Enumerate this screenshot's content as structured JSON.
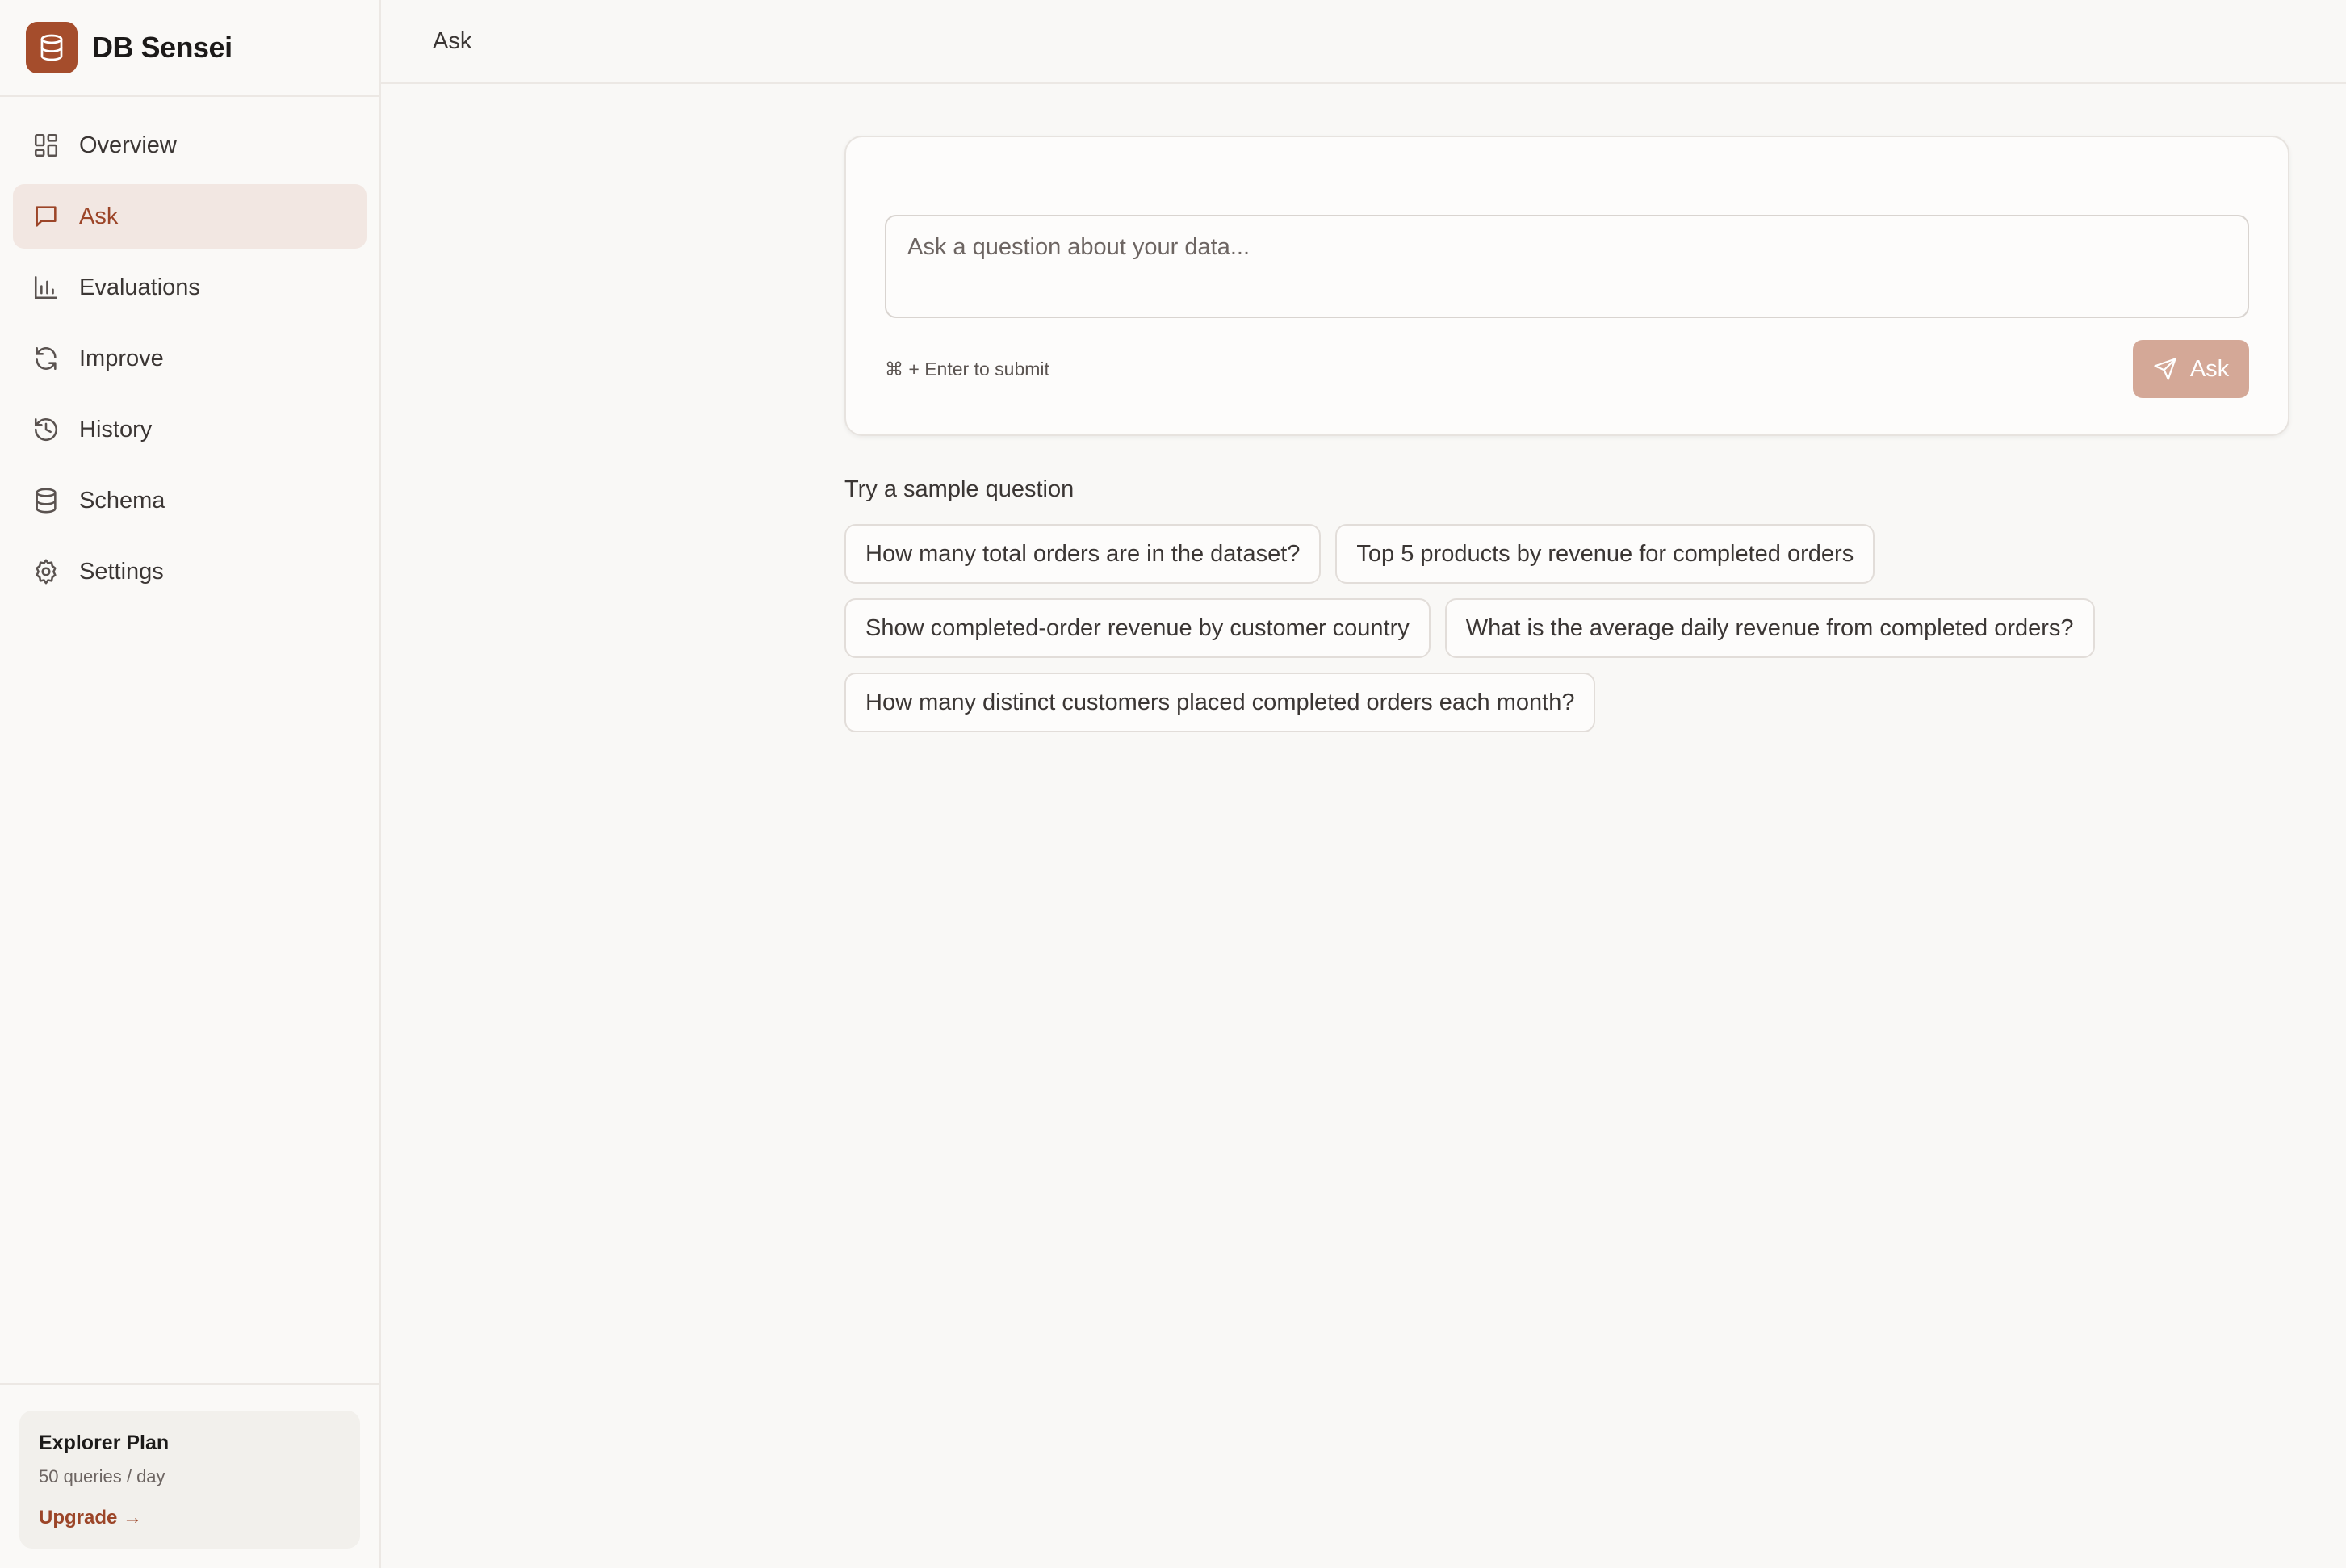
{
  "brand": {
    "name": "DB Sensei",
    "accent": "#a54d2c"
  },
  "sidebar": {
    "items": [
      {
        "label": "Overview",
        "icon": "grid-icon"
      },
      {
        "label": "Ask",
        "icon": "chat-icon",
        "active": true
      },
      {
        "label": "Evaluations",
        "icon": "bar-chart-icon"
      },
      {
        "label": "Improve",
        "icon": "refresh-icon"
      },
      {
        "label": "History",
        "icon": "history-icon"
      },
      {
        "label": "Schema",
        "icon": "database-icon"
      },
      {
        "label": "Settings",
        "icon": "gear-icon"
      }
    ],
    "plan": {
      "title": "Explorer Plan",
      "subtitle": "50 queries / day",
      "upgrade_label": "Upgrade →"
    }
  },
  "header": {
    "title": "Ask"
  },
  "ask": {
    "placeholder": "Ask a question about your data...",
    "hint": "⌘ + Enter to submit",
    "button_label": "Ask",
    "button_color": "#d4a897"
  },
  "samples": {
    "title": "Try a sample question",
    "questions": [
      "How many total orders are in the dataset?",
      "Top 5 products by revenue for completed orders",
      "Show completed-order revenue by customer country",
      "What is the average daily revenue from completed orders?",
      "How many distinct customers placed completed orders each month?"
    ]
  }
}
